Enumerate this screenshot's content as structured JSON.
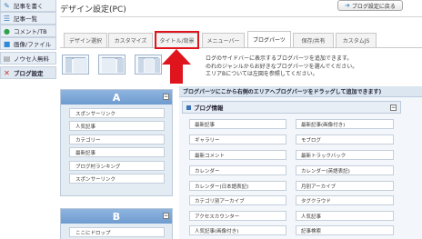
{
  "sidebar": {
    "items": [
      {
        "label": "記事を書く",
        "icon": "pencil-icon",
        "glyph": "✎",
        "color": "#3a7cc4"
      },
      {
        "label": "記事一覧",
        "icon": "list-icon",
        "glyph": "☰",
        "color": "#3a7cc4"
      },
      {
        "label": "コメント/TB",
        "icon": "comment-icon",
        "glyph": "●",
        "color": "#2fa14a"
      },
      {
        "label": "画像/ファイル",
        "icon": "image-icon",
        "glyph": "■",
        "color": "#2e8ad6"
      },
      {
        "label": "ノウセ人無料",
        "icon": "note-icon",
        "glyph": "▤",
        "color": "#888888"
      },
      {
        "label": "ブログ設定",
        "icon": "wrench-icon",
        "glyph": "✕",
        "color": "#c8312b"
      }
    ]
  },
  "header": {
    "title": "デザイン設定(PC)",
    "back_label": "ブログ設定に戻る",
    "back_icon": "arrow-icon"
  },
  "tabs": [
    {
      "label": "デザイン選択",
      "active": false
    },
    {
      "label": "カスタマイズ",
      "active": false
    },
    {
      "label": "タイトル/背景",
      "active": false
    },
    {
      "label": "メニューバー",
      "active": false
    },
    {
      "label": "ブログパーツ",
      "active": true
    },
    {
      "label": "保存/共有",
      "active": false
    },
    {
      "label": "カスタムJS",
      "active": false
    }
  ],
  "description": [
    "ログのサイドバーに表示するブログパーツを追加できます。",
    "のれのジャンルからお好きなブログパーツを選んでください。",
    "エリアBについては左図を参照してください。"
  ],
  "column_a": {
    "title": "A",
    "items": [
      "スポンサーリンク",
      "人気記事",
      "カテゴリー",
      "最新記事",
      "ブログ村ランキング",
      "スポンサーリンク"
    ]
  },
  "column_b": {
    "title": "B",
    "items": [
      "ここにドロップ"
    ]
  },
  "parts_panel": {
    "heading": "ブログパーツにこから右側のエリアへブログパーツをドラッグして追加できます)",
    "group_title": "ブログ情報",
    "left": [
      "最新記事",
      "ギャラリー",
      "最新コメント",
      "カレンダー",
      "カレンダー(日本語表記)",
      "カテゴリ別アーカイブ",
      "アクセスカウンター",
      "人気記事(画像付き)"
    ],
    "right": [
      "最新記事(画像付き)",
      "モブログ",
      "最新トラックバック",
      "カレンダー(英語表記)",
      "月別アーカイブ",
      "タグクラウド",
      "人気記事",
      "記事検索"
    ]
  },
  "colors": {
    "accent": "#6e9bd0",
    "highlight": "#e0141c"
  }
}
